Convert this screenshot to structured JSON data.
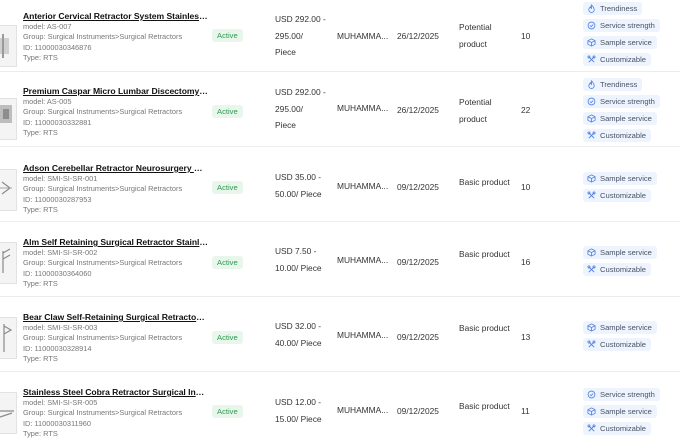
{
  "rows": [
    {
      "title": "Anterior Cervical Retractor System Stainless Steel",
      "model": "model: AS-007",
      "group": "Group: Surgical Instruments>Surgical Retractors",
      "id": "ID: 11000030346876",
      "type": "Type: RTS",
      "status": "Active",
      "price_line1": "USD 292.00 -",
      "price_line2": "295.00/",
      "price_line3": "Piece",
      "supplier": "MUHAMMA...",
      "date": "26/12/2025",
      "product_type_line1": "Potential",
      "product_type_line2": "product",
      "count": "10",
      "tags": [
        {
          "label": "Trendiness",
          "icon": "flame-icon"
        },
        {
          "label": "Service strength",
          "icon": "badge-icon"
        },
        {
          "label": "Sample service",
          "icon": "box-icon"
        },
        {
          "label": "Customizable",
          "icon": "tools-icon"
        }
      ]
    },
    {
      "title": "Premium Caspar Micro Lumbar Discectomy Retractor",
      "model": "model: AS-005",
      "group": "Group: Surgical Instruments>Surgical Retractors",
      "id": "ID: 11000030332881",
      "type": "Type: RTS",
      "status": "Active",
      "price_line1": "USD 292.00 -",
      "price_line2": "295.00/",
      "price_line3": "Piece",
      "supplier": "MUHAMMA...",
      "date": "26/12/2025",
      "product_type_line1": "Potential",
      "product_type_line2": "product",
      "count": "22",
      "tags": [
        {
          "label": "Trendiness",
          "icon": "flame-icon"
        },
        {
          "label": "Service strength",
          "icon": "badge-icon"
        },
        {
          "label": "Sample service",
          "icon": "box-icon"
        },
        {
          "label": "Customizable",
          "icon": "tools-icon"
        }
      ]
    },
    {
      "title": "Adson Cerebellar Retractor Neurosurgery Surgical",
      "model": "model: SMI-SI-SR-001",
      "group": "Group: Surgical Instruments>Surgical Retractors",
      "id": "ID: 11000030287953",
      "type": "Type: RTS",
      "status": "Active",
      "price_line1": "USD 35.00 -",
      "price_line2": "50.00/ Piece",
      "price_line3": "",
      "supplier": "MUHAMMA...",
      "date": "09/12/2025",
      "product_type_line1": "Basic product",
      "product_type_line2": "",
      "count": "10",
      "tags": [
        {
          "label": "Sample service",
          "icon": "box-icon"
        },
        {
          "label": "Customizable",
          "icon": "tools-icon"
        }
      ]
    },
    {
      "title": "Alm Self Retaining Surgical Retractor Stainless Steel",
      "model": "model: SMI-SI-SR-002",
      "group": "Group: Surgical Instruments>Surgical Retractors",
      "id": "ID: 11000030364060",
      "type": "Type: RTS",
      "status": "Active",
      "price_line1": "USD 7.50 -",
      "price_line2": "10.00/ Piece",
      "price_line3": "",
      "supplier": "MUHAMMA...",
      "date": "09/12/2025",
      "product_type_line1": "Basic product",
      "product_type_line2": "",
      "count": "16",
      "tags": [
        {
          "label": "Sample service",
          "icon": "box-icon"
        },
        {
          "label": "Customizable",
          "icon": "tools-icon"
        }
      ]
    },
    {
      "title": "Bear Claw Self-Retaining Surgical Retractor Stainless",
      "model": "model: SMI-SI-SR-003",
      "group": "Group: Surgical Instruments>Surgical Retractors",
      "id": "ID: 11000030328914",
      "type": "Type: RTS",
      "status": "Active",
      "price_line1": "USD 32.00 -",
      "price_line2": "40.00/ Piece",
      "price_line3": "",
      "supplier": "MUHAMMA...",
      "date": "09/12/2025",
      "product_type_line1": "Basic product",
      "product_type_line2": "",
      "count": "13",
      "tags": [
        {
          "label": "Sample service",
          "icon": "box-icon"
        },
        {
          "label": "Customizable",
          "icon": "tools-icon"
        }
      ]
    },
    {
      "title": "Stainless Steel Cobra Retractor Surgical Instruments",
      "model": "model: SMI-SI-SR-005",
      "group": "Group: Surgical Instruments>Surgical Retractors",
      "id": "ID: 11000030311960",
      "type": "Type: RTS",
      "status": "Active",
      "price_line1": "USD 12.00 -",
      "price_line2": "15.00/ Piece",
      "price_line3": "",
      "supplier": "MUHAMMA...",
      "date": "09/12/2025",
      "product_type_line1": "Basic product",
      "product_type_line2": "",
      "count": "11",
      "tags": [
        {
          "label": "Service strength",
          "icon": "badge-icon"
        },
        {
          "label": "Sample service",
          "icon": "box-icon"
        },
        {
          "label": "Customizable",
          "icon": "tools-icon"
        }
      ]
    }
  ]
}
